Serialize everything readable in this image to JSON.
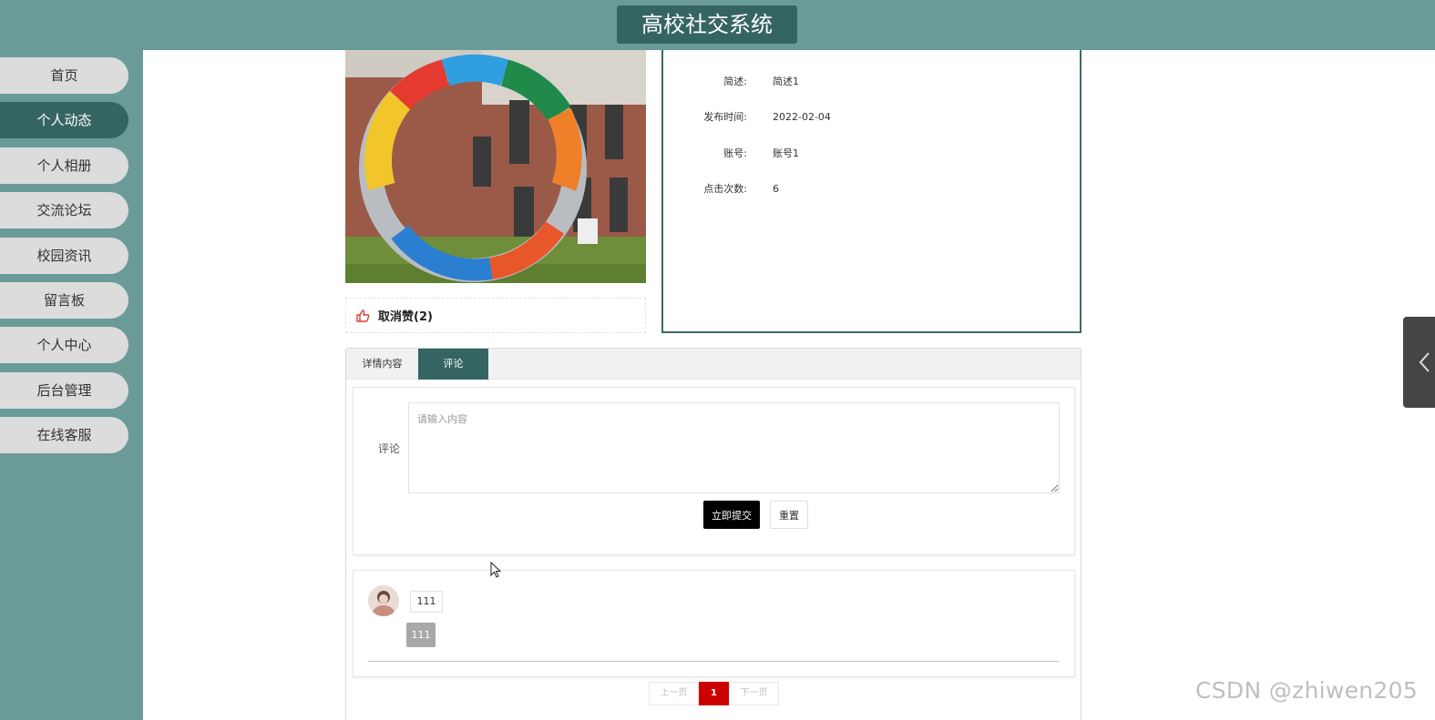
{
  "header": {
    "title": "高校社交系统"
  },
  "sidebar": {
    "items": [
      {
        "label": "首页",
        "active": false
      },
      {
        "label": "个人动态",
        "active": true
      },
      {
        "label": "个人相册",
        "active": false
      },
      {
        "label": "交流论坛",
        "active": false
      },
      {
        "label": "校园资讯",
        "active": false
      },
      {
        "label": "留言板",
        "active": false
      },
      {
        "label": "个人中心",
        "active": false
      },
      {
        "label": "后台管理",
        "active": false
      },
      {
        "label": "在线客服",
        "active": false
      }
    ]
  },
  "detail": {
    "like_label": "取消赞(2)",
    "fields": [
      {
        "key": "简述:",
        "value": "简述1"
      },
      {
        "key": "发布时间:",
        "value": "2022-02-04"
      },
      {
        "key": "账号:",
        "value": "账号1"
      },
      {
        "key": "点击次数:",
        "value": "6"
      }
    ]
  },
  "tabs": [
    {
      "label": "详情内容",
      "active": false
    },
    {
      "label": "评论",
      "active": true
    }
  ],
  "comment_form": {
    "label": "评论",
    "placeholder": "请输入内容",
    "value": "",
    "submit_label": "立即提交",
    "reset_label": "重置"
  },
  "comments": [
    {
      "content": "111",
      "reply": "111"
    }
  ],
  "pagination": {
    "prev_label": "上一页",
    "current": "1",
    "next_label": "下一页"
  },
  "watermark": "CSDN @zhiwen205",
  "colors": {
    "theme": "#6a9b99",
    "theme_dark": "#356563",
    "page_active": "#cc0000"
  }
}
